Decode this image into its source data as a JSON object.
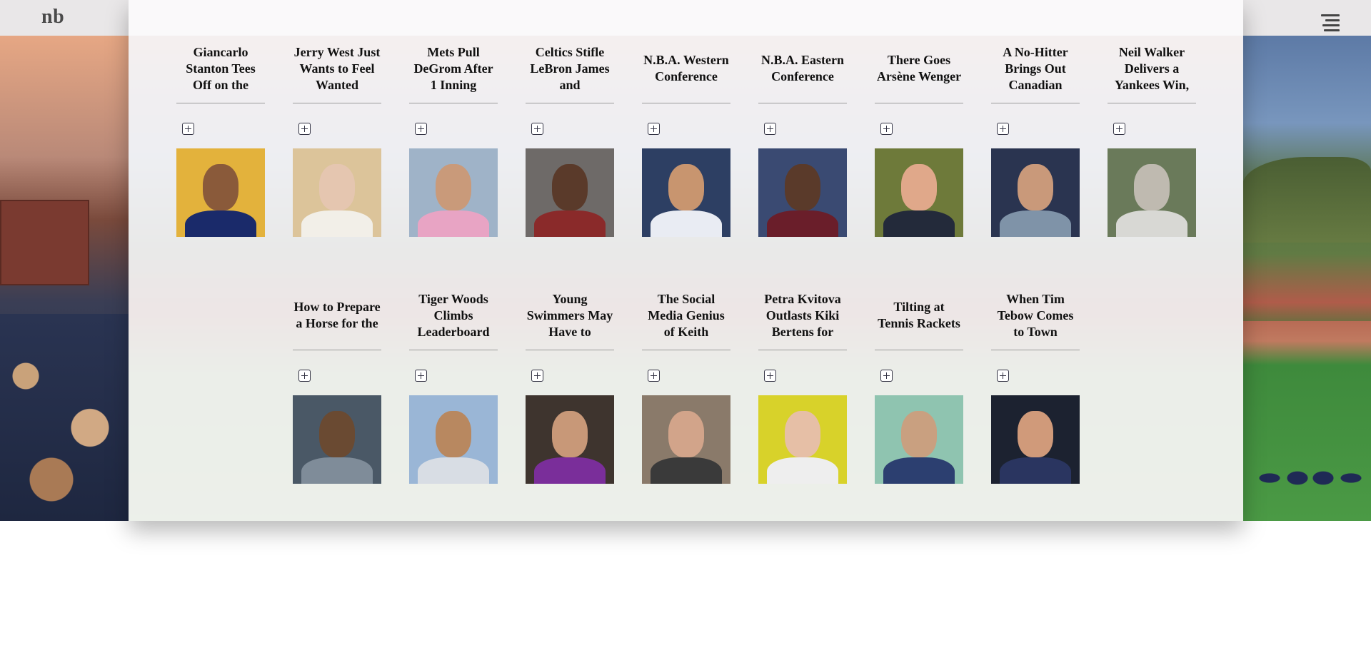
{
  "brand": {
    "logo_text": "nb"
  },
  "header": {
    "menu_icon": "hamburger-menu-icon"
  },
  "add_icon": "plus-square-icon",
  "rows": [
    {
      "articles": [
        {
          "title": "Giancarlo Stanton Tees Off on the",
          "thumb_bg": "#e3b23c",
          "skin": "#8a5a3a",
          "shirt": "#1a2a6a"
        },
        {
          "title": "Jerry West Just Wants to Feel Wanted",
          "thumb_bg": "#dcc49a",
          "skin": "#e5c6b0",
          "shirt": "#f2efe8"
        },
        {
          "title": "Mets Pull DeGrom After 1 Inning",
          "thumb_bg": "#9fb3c8",
          "skin": "#c99a7a",
          "shirt": "#e8a4c4"
        },
        {
          "title": "Celtics Stifle LeBron James and",
          "thumb_bg": "#6e6a68",
          "skin": "#5a3a2a",
          "shirt": "#8a2a2a"
        },
        {
          "title": "N.B.A. Western Conference",
          "thumb_bg": "#2d3f63",
          "skin": "#c8956f",
          "shirt": "#e9ecf3"
        },
        {
          "title": "N.B.A. Eastern Conference",
          "thumb_bg": "#3a4a72",
          "skin": "#5a3a2a",
          "shirt": "#6a1e2a"
        },
        {
          "title": "There Goes Arsène Wenger",
          "thumb_bg": "#6e7a3a",
          "skin": "#e0a88a",
          "shirt": "#232a3a"
        },
        {
          "title": "A No-Hitter Brings Out Canadian",
          "thumb_bg": "#2a3450",
          "skin": "#c9997a",
          "shirt": "#7f93a8"
        },
        {
          "title": "Neil Walker Delivers a Yankees Win,",
          "thumb_bg": "#6a7a5a",
          "skin": "#bfbab0",
          "shirt": "#d8d8d4"
        }
      ]
    },
    {
      "articles": [
        {
          "title": "How to Prepare a Horse for the",
          "thumb_bg": "#4a5866",
          "skin": "#6a4a32",
          "shirt": "#7f8c99"
        },
        {
          "title": "Tiger Woods Climbs Leaderboard",
          "thumb_bg": "#9ab6d6",
          "skin": "#b88860",
          "shirt": "#d8dde4"
        },
        {
          "title": "Young Swimmers May Have to",
          "thumb_bg": "#3e342e",
          "skin": "#c89878",
          "shirt": "#7a2e9a"
        },
        {
          "title": "The Social Media Genius of Keith",
          "thumb_bg": "#8a7a6a",
          "skin": "#d2a48a",
          "shirt": "#3a3a3a"
        },
        {
          "title": "Petra Kvitova Outlasts Kiki Bertens for",
          "thumb_bg": "#d8d22a",
          "skin": "#e6bfa6",
          "shirt": "#eeeeee"
        },
        {
          "title": "Tilting at Tennis Rackets",
          "thumb_bg": "#8fc4b0",
          "skin": "#c9a080",
          "shirt": "#2c3f70"
        },
        {
          "title": "When Tim Tebow Comes to Town",
          "thumb_bg": "#1c2230",
          "skin": "#d09a7a",
          "shirt": "#2a3560"
        }
      ]
    }
  ]
}
